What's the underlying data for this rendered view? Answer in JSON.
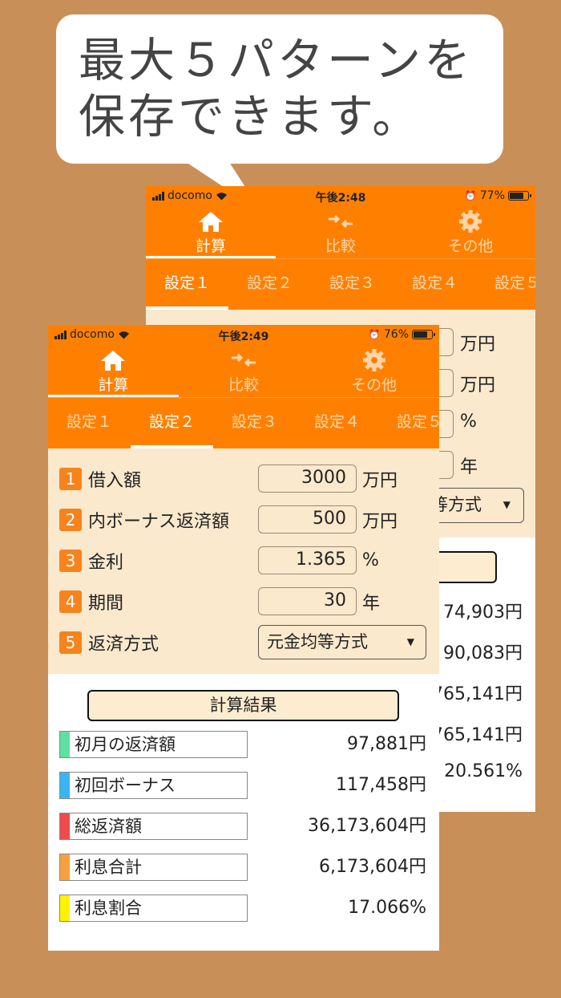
{
  "promo": {
    "line1": "最大５パターンを",
    "line2": "保存できます。"
  },
  "back_screen": {
    "status": {
      "carrier": "docomo",
      "time": "午後2:48",
      "battery": "77%",
      "battery_level": 0.77
    },
    "nav": {
      "calc": "計算",
      "compare": "比較",
      "other": "その他"
    },
    "tabs": [
      "設定１",
      "設定２",
      "設定３",
      "設定４",
      "設定５"
    ],
    "units": [
      "万円",
      "万円",
      "%",
      "年"
    ],
    "method_partial": "等方式",
    "values": [
      "74,903円",
      "90,083円",
      "765,141円",
      "765,141円",
      "20.561%"
    ]
  },
  "front_screen": {
    "status": {
      "carrier": "docomo",
      "time": "午後2:49",
      "battery": "76%",
      "battery_level": 0.76
    },
    "nav": {
      "calc": "計算",
      "compare": "比較",
      "other": "その他"
    },
    "tabs": [
      "設定１",
      "設定２",
      "設定３",
      "設定４",
      "設定５"
    ],
    "inputs": [
      {
        "num": "1",
        "label": "借入額",
        "value": "3000",
        "unit": "万円"
      },
      {
        "num": "2",
        "label": "内ボーナス返済額",
        "value": "500",
        "unit": "万円"
      },
      {
        "num": "3",
        "label": "金利",
        "value": "1.365",
        "unit": "%"
      },
      {
        "num": "4",
        "label": "期間",
        "value": "30",
        "unit": "年"
      }
    ],
    "method": {
      "num": "5",
      "label": "返済方式",
      "value": "元金均等方式"
    },
    "result_button": "計算結果",
    "results": [
      {
        "label": "初月の返済額",
        "value": "97,881円",
        "color": "#5ee0a0"
      },
      {
        "label": "初回ボーナス",
        "value": "117,458円",
        "color": "#3bb4f2"
      },
      {
        "label": "総返済額",
        "value": "36,173,604円",
        "color": "#f04a4a"
      },
      {
        "label": "利息合計",
        "value": "6,173,604円",
        "color": "#f7a040"
      },
      {
        "label": "利息割合",
        "value": "17.066%",
        "color": "#fff200"
      }
    ]
  }
}
